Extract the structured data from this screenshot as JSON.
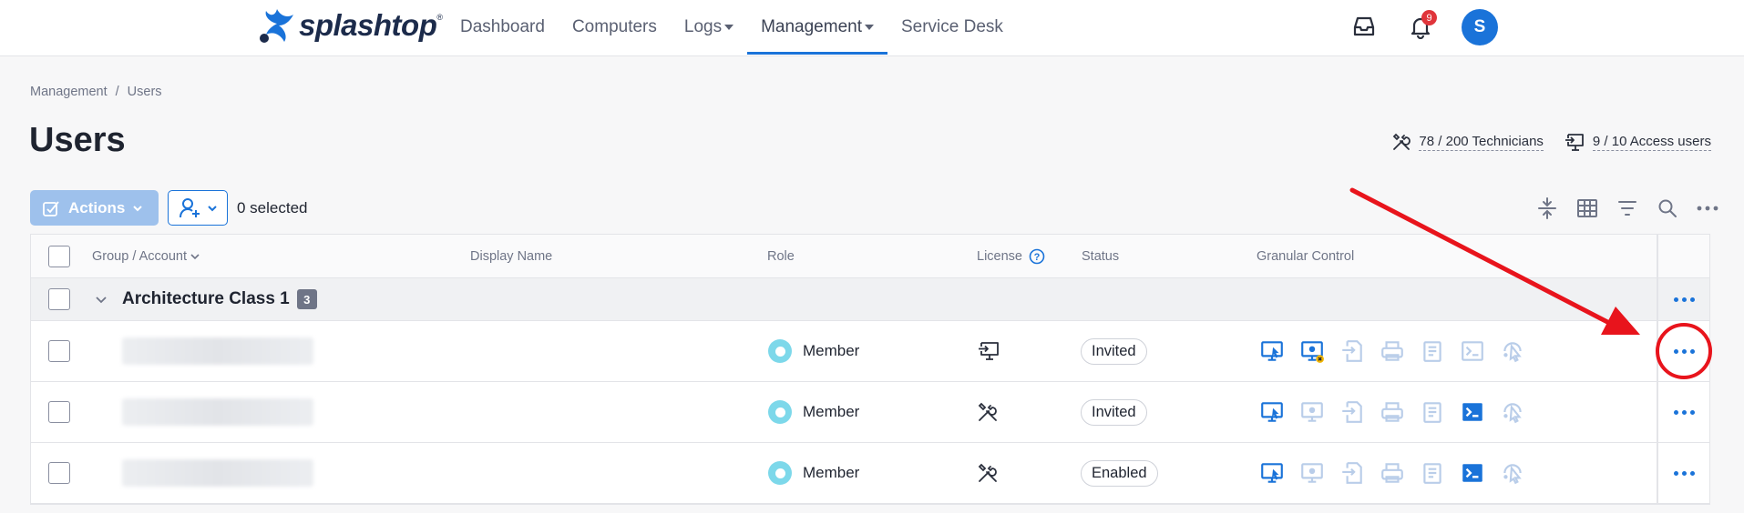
{
  "nav": {
    "logo_text": "splashtop",
    "logo_reg": "®",
    "items": [
      {
        "label": "Dashboard",
        "caret": false,
        "active": false
      },
      {
        "label": "Computers",
        "caret": false,
        "active": false
      },
      {
        "label": "Logs",
        "caret": true,
        "active": false
      },
      {
        "label": "Management",
        "caret": true,
        "active": true
      },
      {
        "label": "Service Desk",
        "caret": false,
        "active": false
      }
    ],
    "notification_count": "9",
    "avatar_initial": "S"
  },
  "breadcrumb": {
    "parent": "Management",
    "separator": "/",
    "current": "Users"
  },
  "page": {
    "title": "Users"
  },
  "licenses": {
    "technicians": "78 / 200 Technicians",
    "access_users": "9 / 10 Access users"
  },
  "toolbar": {
    "actions_label": "Actions",
    "selected_text": "0 selected",
    "tool_icons": [
      "collapse-icon",
      "columns-icon",
      "filter-icon",
      "search-icon",
      "more-icon"
    ]
  },
  "table": {
    "headers": {
      "group_account": "Group / Account",
      "display_name": "Display Name",
      "role": "Role",
      "license": "License",
      "status": "Status",
      "granular_control": "Granular Control"
    },
    "group": {
      "name": "Architecture Class 1",
      "count": "3"
    },
    "rows": [
      {
        "role": "Member",
        "license_icon": "access-license-icon",
        "status": "Invited",
        "granular": [
          true,
          "partial",
          false,
          false,
          false,
          false,
          false
        ]
      },
      {
        "role": "Member",
        "license_icon": "technician-license-icon",
        "status": "Invited",
        "granular": [
          true,
          false,
          false,
          false,
          false,
          true,
          false
        ]
      },
      {
        "role": "Member",
        "license_icon": "technician-license-icon",
        "status": "Enabled",
        "granular": [
          true,
          false,
          false,
          false,
          false,
          true,
          false
        ]
      }
    ],
    "granular_icon_names": [
      "remote-access-icon",
      "remote-view-icon",
      "file-transfer-icon",
      "remote-print-icon",
      "clipboard-icon",
      "terminal-icon",
      "remote-command-icon"
    ]
  },
  "colors": {
    "accent": "#1a73d9",
    "annotation": "#e8141c",
    "badge": "#e0353b",
    "role_dot": "#7dd8ea"
  }
}
